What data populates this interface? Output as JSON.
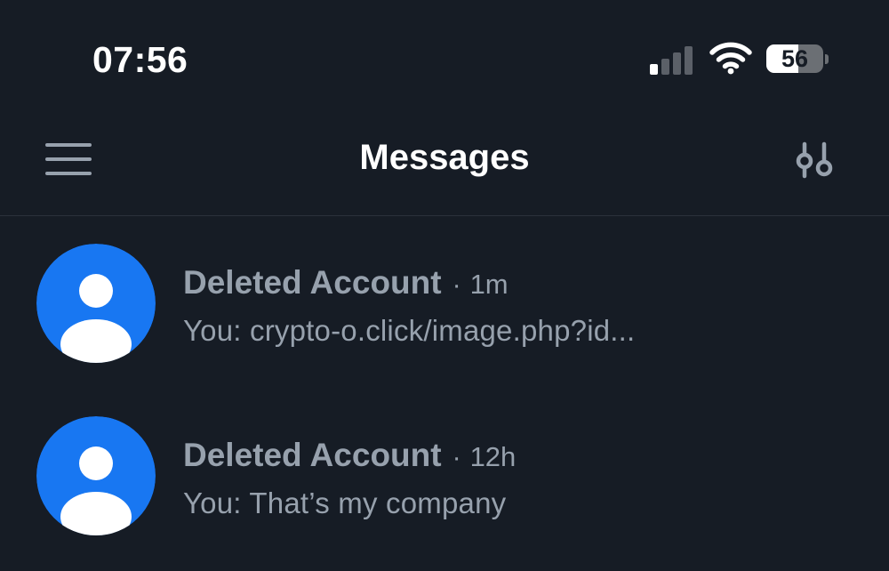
{
  "status_bar": {
    "time": "07:56",
    "battery_level": "56",
    "battery_fraction": 0.56,
    "icons": [
      "cellular-signal-icon",
      "wifi-icon",
      "battery-icon"
    ]
  },
  "header": {
    "title": "Messages",
    "left_icon": "hamburger-menu-icon",
    "right_icon": "filter-sliders-icon"
  },
  "colors": {
    "background": "#161c25",
    "avatar": "#1877f2",
    "secondary_text": "#97a1ad",
    "header_icons": "#97a1ad"
  },
  "conversations": [
    {
      "name": "Deleted Account",
      "separator": "·",
      "time": "1m",
      "preview": "You: crypto-o.click/image.php?id...",
      "avatar_icon": "default-user-avatar-icon"
    },
    {
      "name": "Deleted Account",
      "separator": "·",
      "time": "12h",
      "preview": "You: That’s my company",
      "avatar_icon": "default-user-avatar-icon"
    }
  ]
}
